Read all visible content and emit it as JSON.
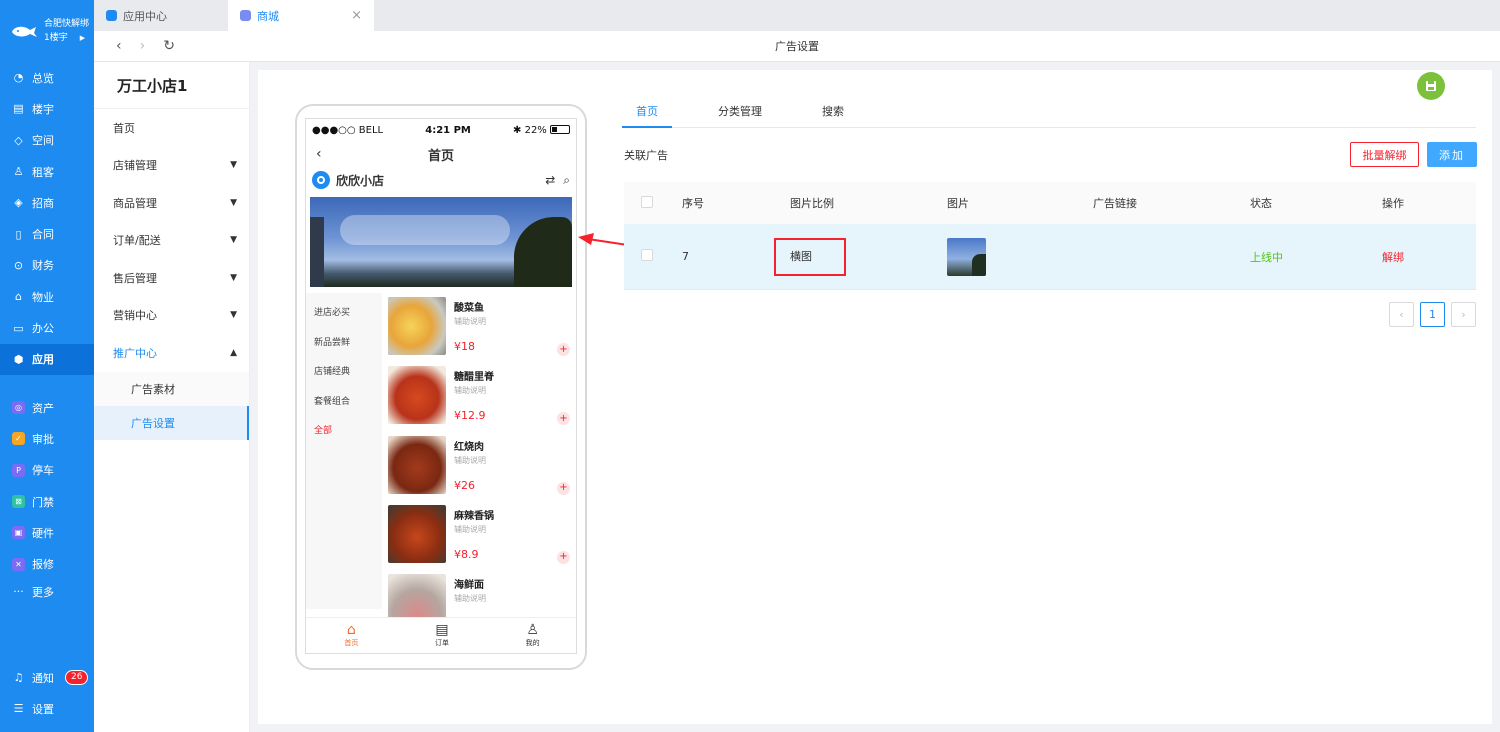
{
  "brand": {
    "name": "合肥快解绑",
    "building": "1楼宇"
  },
  "leftnav": {
    "items": [
      {
        "label": "总览",
        "icon": "dashboard-icon"
      },
      {
        "label": "楼宇",
        "icon": "building-icon"
      },
      {
        "label": "空间",
        "icon": "cube-icon"
      },
      {
        "label": "租客",
        "icon": "users-icon"
      },
      {
        "label": "招商",
        "icon": "tag-icon"
      },
      {
        "label": "合同",
        "icon": "document-icon"
      },
      {
        "label": "财务",
        "icon": "money-icon"
      },
      {
        "label": "物业",
        "icon": "home-icon"
      },
      {
        "label": "办公",
        "icon": "monitor-icon"
      },
      {
        "label": "应用",
        "icon": "app-icon"
      }
    ],
    "apps": [
      {
        "label": "资产",
        "icon": "asset-icon",
        "color": "#7b6cf6"
      },
      {
        "label": "审批",
        "icon": "approval-icon",
        "color": "#f5a623"
      },
      {
        "label": "停车",
        "icon": "parking-icon",
        "color": "#7b6cf6"
      },
      {
        "label": "门禁",
        "icon": "door-icon",
        "color": "#2fc3a3"
      },
      {
        "label": "硬件",
        "icon": "hardware-icon",
        "color": "#7b6cf6"
      },
      {
        "label": "报修",
        "icon": "repair-icon",
        "color": "#7b6cf6"
      },
      {
        "label": "更多",
        "icon": "more-icon"
      }
    ],
    "notify_label": "通知",
    "notify_count": "26",
    "settings_label": "设置"
  },
  "tabs": [
    {
      "label": "应用中心",
      "color": "#1e8bf0"
    },
    {
      "label": "商城",
      "color": "#7b8cf0"
    }
  ],
  "header": {
    "title": "广告设置"
  },
  "subside": {
    "shop_title": "万工小店1",
    "items": [
      {
        "label": "首页"
      },
      {
        "label": "店铺管理"
      },
      {
        "label": "商品管理"
      },
      {
        "label": "订单/配送"
      },
      {
        "label": "售后管理"
      },
      {
        "label": "营销中心"
      },
      {
        "label": "推广中心"
      }
    ],
    "sub_items": [
      "广告素材",
      "广告设置"
    ]
  },
  "phone": {
    "carrier": "●●●○○ BELL",
    "time": "4:21 PM",
    "battery": "22%",
    "nav_title": "首页",
    "shop_name": "欣欣小店",
    "categories": [
      "进店必买",
      "新品尝鲜",
      "店铺经典",
      "套餐组合",
      "全部"
    ],
    "goods": [
      {
        "name": "酸菜鱼",
        "sub": "辅助说明",
        "price": "¥18"
      },
      {
        "name": "糖醋里脊",
        "sub": "辅助说明",
        "price": "¥12.9"
      },
      {
        "name": "红烧肉",
        "sub": "辅助说明",
        "price": "¥26"
      },
      {
        "name": "麻辣香锅",
        "sub": "辅助说明",
        "price": "¥8.9"
      },
      {
        "name": "海鲜面",
        "sub": "辅助说明",
        "price": ""
      }
    ],
    "tabbar": [
      {
        "label": "首页",
        "icon": "home-icon"
      },
      {
        "label": "订单",
        "icon": "order-icon"
      },
      {
        "label": "我的",
        "icon": "user-icon"
      }
    ]
  },
  "rtabs": [
    "首页",
    "分类管理",
    "搜索"
  ],
  "linked_label": "关联广告",
  "buttons": {
    "batch_unbind": "批量解绑",
    "add": "添加"
  },
  "table": {
    "headers": [
      "序号",
      "图片比例",
      "图片",
      "广告链接",
      "状态",
      "操作"
    ],
    "rows": [
      {
        "index": "7",
        "ratio": "横图",
        "link": "",
        "status": "上线中",
        "action": "解绑"
      }
    ]
  },
  "pagination": {
    "current": "1"
  }
}
